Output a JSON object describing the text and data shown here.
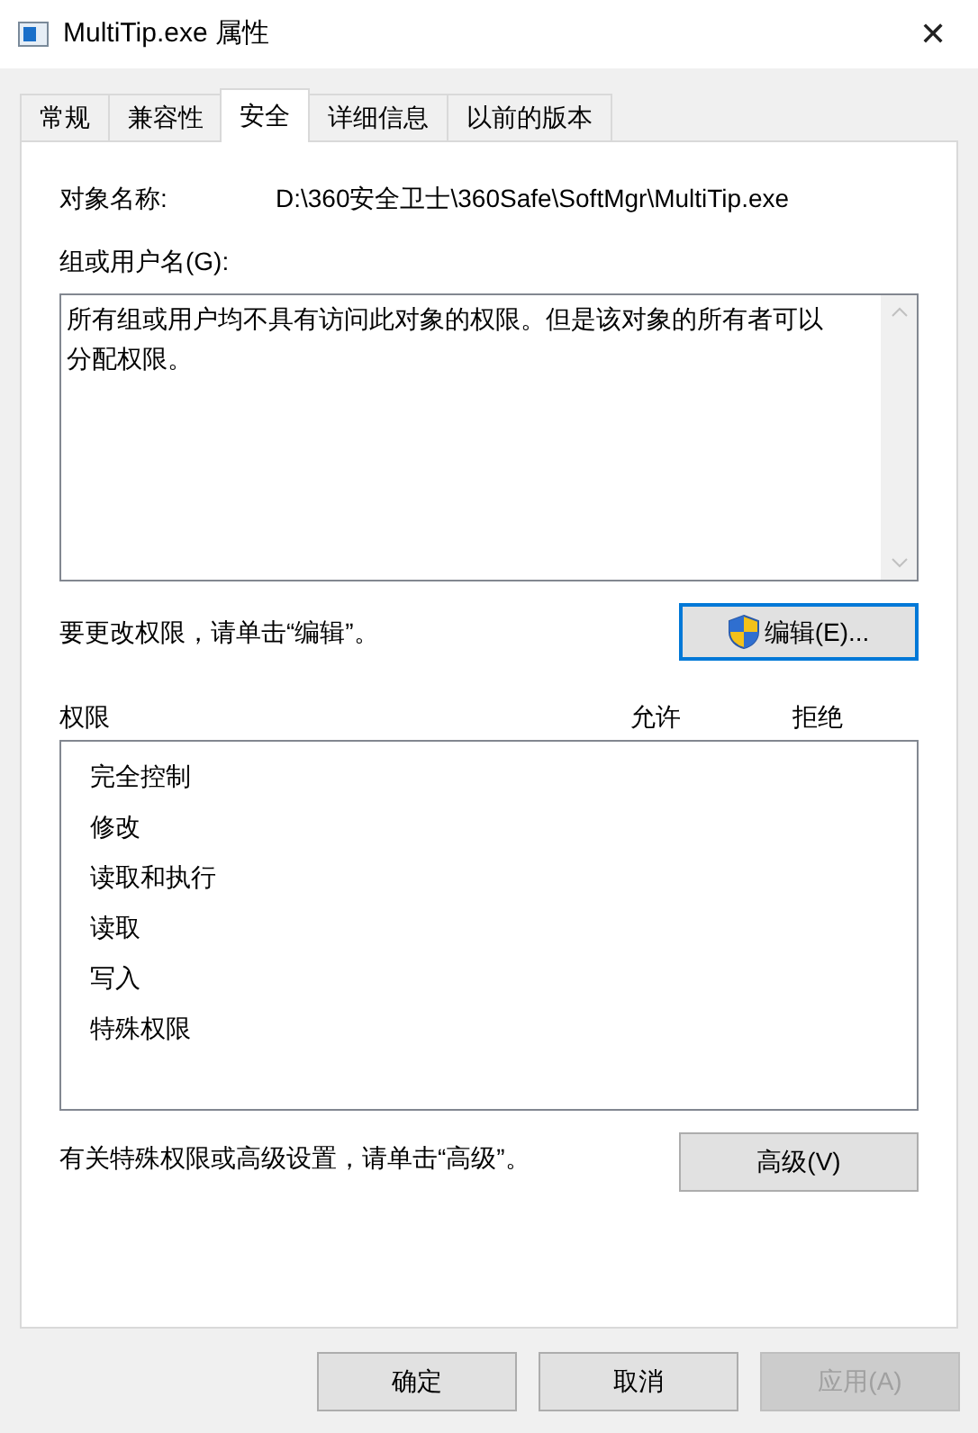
{
  "window": {
    "title": "MultiTip.exe 属性",
    "close": "✕"
  },
  "tabs": [
    {
      "label": "常规",
      "selected": false
    },
    {
      "label": "兼容性",
      "selected": false
    },
    {
      "label": "安全",
      "selected": true
    },
    {
      "label": "详细信息",
      "selected": false
    },
    {
      "label": "以前的版本",
      "selected": false
    }
  ],
  "object_name": {
    "label": "对象名称:",
    "value": "D:\\360安全卫士\\360Safe\\SoftMgr\\MultiTip.exe"
  },
  "groups": {
    "label": "组或用户名(G):",
    "message": "所有组或用户均不具有访问此对象的权限。但是该对象的所有者可以分配权限。"
  },
  "edit_hint": "要更改权限，请单击“编辑”。",
  "edit_button": "编辑(E)...",
  "permissions": {
    "columns": [
      "权限",
      "允许",
      "拒绝"
    ],
    "rows": [
      "完全控制",
      "修改",
      "读取和执行",
      "读取",
      "写入",
      "特殊权限"
    ]
  },
  "advanced_hint": "有关特殊权限或高级设置，请单击“高级”。",
  "advanced_button": "高级(V)",
  "buttons": [
    {
      "label": "确定",
      "disabled": false
    },
    {
      "label": "取消",
      "disabled": false
    },
    {
      "label": "应用(A)",
      "disabled": true
    }
  ]
}
